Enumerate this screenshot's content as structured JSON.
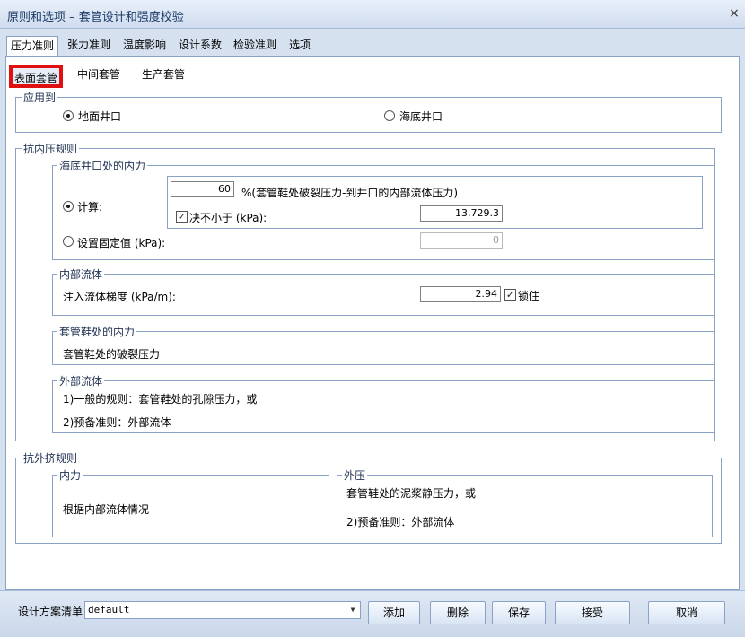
{
  "window": {
    "title": "原则和选项 – 套管设计和强度校验",
    "close_glyph": "×"
  },
  "tabs": [
    "压力准则",
    "张力准则",
    "温度影响",
    "设计系数",
    "检验准则",
    "选项"
  ],
  "subtabs": [
    "表面套管",
    "中间套管",
    "生产套管"
  ],
  "apply_to": {
    "legend": "应用到",
    "surface": "地面井口",
    "subsea": "海底井口"
  },
  "burst": {
    "legend": "抗内压规则",
    "wellhead": {
      "legend": "海底井口处的内力",
      "calc_label": "计算:",
      "percent_value": "60",
      "percent_desc": "%(套管鞋处破裂压力-到井口的内部流体压力)",
      "min_label": "决不小于 (kPa):",
      "min_value": "13,729.3",
      "fixed_label": "设置固定值 (kPa):",
      "fixed_value": "0",
      "check_glyph": "✓"
    },
    "internal_fluid": {
      "legend": "内部流体",
      "gradient_label": "注入流体梯度 (kPa/m):",
      "gradient_value": "2.94",
      "lock_label": "锁住"
    },
    "shoe": {
      "legend": "套管鞋处的内力",
      "text": "套管鞋处的破裂压力"
    },
    "external": {
      "legend": "外部流体",
      "line1": "1)一般的规则：套管鞋处的孔隙压力，或",
      "line2": "2)预备准则：外部流体"
    }
  },
  "collapse": {
    "legend": "抗外挤规则",
    "internal": {
      "legend": "内力",
      "text": "根据内部流体情况"
    },
    "external": {
      "legend": "外压",
      "line1": "套管鞋处的泥浆静压力，或",
      "line2": "2)预备准则：外部流体"
    }
  },
  "footer": {
    "list_label": "设计方案清单",
    "list_value": "default",
    "add": "添加",
    "delete": "删除",
    "save": "保存",
    "accept": "接受",
    "cancel": "取消"
  }
}
